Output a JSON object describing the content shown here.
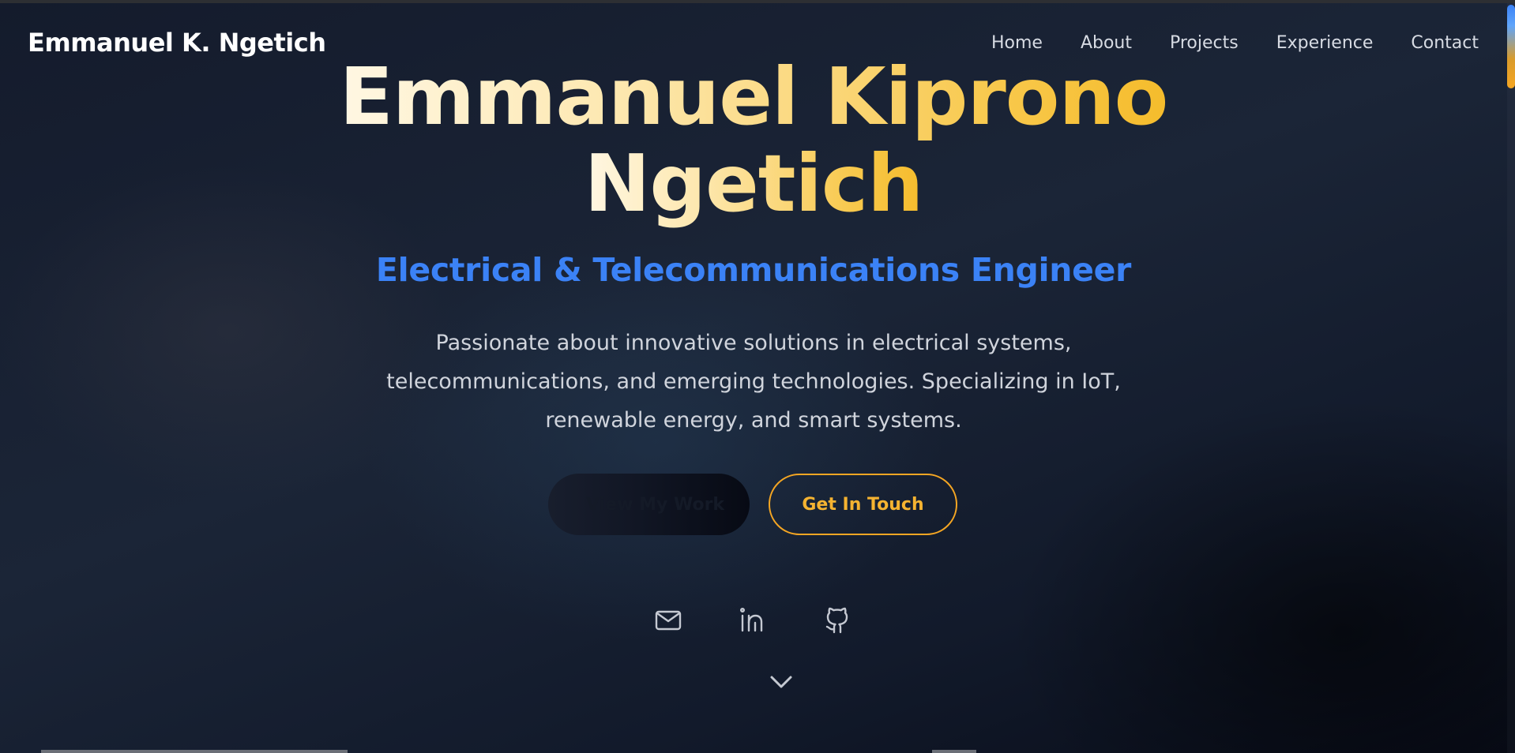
{
  "navbar": {
    "brand": "Emmanuel K. Ngetich",
    "links": [
      "Home",
      "About",
      "Projects",
      "Experience",
      "Contact"
    ]
  },
  "hero": {
    "title_line1": "Emmanuel Kiprono",
    "title_line2": "Ngetich",
    "subtitle": "Electrical & Telecommunications Engineer",
    "description": "Passionate about innovative solutions in electrical systems, telecommunications, and emerging technologies. Specializing in IoT, renewable energy, and smart systems.",
    "primary_button": "View My Work",
    "secondary_button": "Get In Touch"
  },
  "social_icons": [
    "mail-icon",
    "linkedin-icon",
    "github-icon"
  ],
  "scroll_icon": "chevron-down-icon",
  "colors": {
    "accent_gold": "#f5a623",
    "accent_blue": "#3b82f6",
    "background": "#151d2e"
  }
}
